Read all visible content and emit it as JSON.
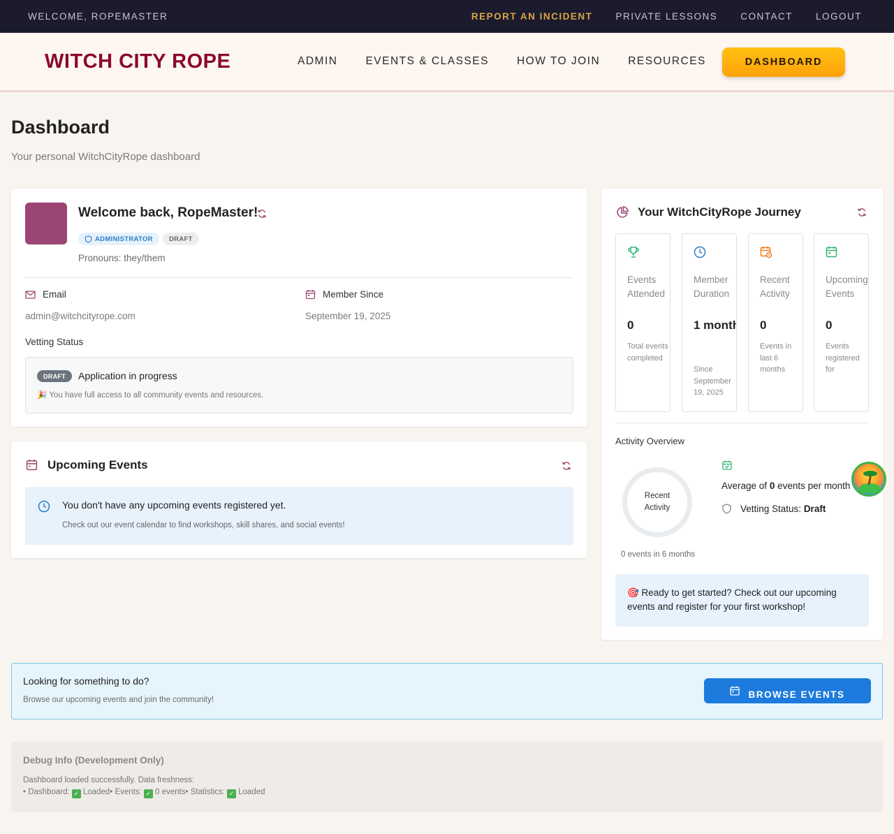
{
  "topbar": {
    "welcome": "WELCOME, ROPEMASTER",
    "links": [
      {
        "label": "REPORT AN INCIDENT"
      },
      {
        "label": "PRIVATE LESSONS"
      },
      {
        "label": "CONTACT"
      },
      {
        "label": "LOGOUT"
      }
    ]
  },
  "navbar": {
    "logo": "WITCH CITY ROPE",
    "items": [
      {
        "label": "ADMIN"
      },
      {
        "label": "EVENTS & CLASSES"
      },
      {
        "label": "HOW TO JOIN"
      },
      {
        "label": "RESOURCES"
      }
    ],
    "dashboard_button": "DASHBOARD"
  },
  "page": {
    "title": "Dashboard",
    "subtitle": "Your personal WitchCityRope dashboard"
  },
  "profile": {
    "welcome": "Welcome back, RopeMaster!",
    "role_badge": "ADMINISTRATOR",
    "status_badge": "DRAFT",
    "pronouns": "Pronouns: they/them",
    "email_label": "Email",
    "email_value": "admin@witchcityrope.com",
    "member_since_label": "Member Since",
    "member_since_value": "September 19, 2025",
    "vetting_label": "Vetting Status",
    "vetting_badge": "DRAFT",
    "vetting_status": "Application in progress",
    "vetting_note": "🎉 You have full access to all community events and resources."
  },
  "upcoming": {
    "title": "Upcoming Events",
    "empty_title": "You don't have any upcoming events registered yet.",
    "empty_sub": "Check out our event calendar to find workshops, skill shares, and social events!"
  },
  "journey": {
    "title": "Your WitchCityRope Journey",
    "stats": [
      {
        "label": "Events Attended",
        "value": "0",
        "desc": "Total events completed",
        "icon": "trophy-icon",
        "color": "#2bb673"
      },
      {
        "label": "Member Duration",
        "value": "1 month",
        "desc": "Since September 19, 2025",
        "icon": "clock-icon",
        "color": "#2d7ec9"
      },
      {
        "label": "Recent Activity",
        "value": "0",
        "desc": "Events in last 6 months",
        "icon": "calendar-clock-icon",
        "color": "#f07a1a"
      },
      {
        "label": "Upcoming Events",
        "value": "0",
        "desc": "Events registered for",
        "icon": "calendar-icon",
        "color": "#2bb673"
      }
    ],
    "activity_title": "Activity Overview",
    "ring_label": "Recent Activity",
    "ring_caption": "0 events in 6 months",
    "avg_prefix": "Average of ",
    "avg_value": "0",
    "avg_suffix": " events per month",
    "vetting_prefix": "Vetting Status: ",
    "vetting_value": "Draft",
    "ready_text": "🎯 Ready to get started? Check out our upcoming events and register for your first workshop!"
  },
  "cta": {
    "title": "Looking for something to do?",
    "sub": "Browse our upcoming events and join the community!",
    "button": "BROWSE EVENTS"
  },
  "debug": {
    "title": "Debug Info (Development Only)",
    "line1": "Dashboard loaded successfully. Data freshness:",
    "dash_label": "• Dashboard: ",
    "dash_value": "Loaded",
    "events_label": "• Events: ",
    "events_value": "0 events",
    "stats_label": "• Statistics: ",
    "stats_value": "Loaded"
  },
  "colors": {
    "brand": "#8a0a2c",
    "accent": "#ffb20e",
    "primary_button": "#1c7bdc",
    "topbar": "#1c1b2e"
  }
}
